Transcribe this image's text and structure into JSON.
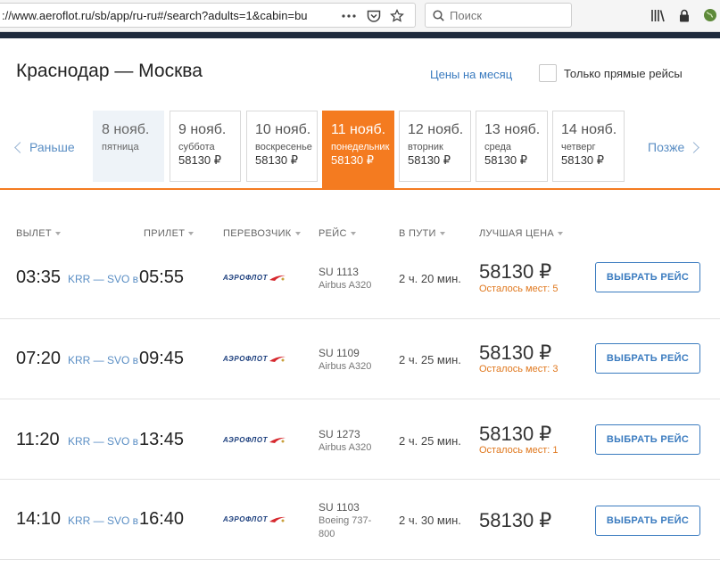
{
  "browser": {
    "url": "://www.aeroflot.ru/sb/app/ru-ru#/search?adults=1&cabin=bu",
    "search_placeholder": "Поиск"
  },
  "header": {
    "route_title": "Краснодар — Москва",
    "month_prices_link": "Цены на месяц",
    "direct_only_label": "Только прямые рейсы"
  },
  "date_strip": {
    "prev_label": "Раньше",
    "next_label": "Позже",
    "days": [
      {
        "date": "8 нояб.",
        "weekday": "пятница",
        "price": ""
      },
      {
        "date": "9 нояб.",
        "weekday": "суббота",
        "price": "58130 ₽"
      },
      {
        "date": "10 нояб.",
        "weekday": "воскресенье",
        "price": "58130 ₽"
      },
      {
        "date": "11 нояб.",
        "weekday": "понедельник",
        "price": "58130 ₽"
      },
      {
        "date": "12 нояб.",
        "weekday": "вторник",
        "price": "58130 ₽"
      },
      {
        "date": "13 нояб.",
        "weekday": "среда",
        "price": "58130 ₽"
      },
      {
        "date": "14 нояб.",
        "weekday": "четверг",
        "price": "58130 ₽"
      }
    ]
  },
  "table_headers": {
    "departure": "ВЫЛЕТ",
    "arrival": "ПРИЛЕТ",
    "carrier": "ПЕРЕВОЗЧИК",
    "flight": "РЕЙС",
    "duration": "В ПУТИ",
    "best_price": "ЛУЧШАЯ ЦЕНА"
  },
  "carrier_logo_text": "АЭРОФЛОТ",
  "flights": [
    {
      "dep": "03:35",
      "route": "KRR — SVO в",
      "arr": "05:55",
      "flight": "SU 1113",
      "aircraft": "Airbus A320",
      "duration": "2 ч. 20 мин.",
      "price": "58130 ₽",
      "seats": "Осталось мест: 5",
      "button": "ВЫБРАТЬ РЕЙС"
    },
    {
      "dep": "07:20",
      "route": "KRR — SVO в",
      "arr": "09:45",
      "flight": "SU 1109",
      "aircraft": "Airbus A320",
      "duration": "2 ч. 25 мин.",
      "price": "58130 ₽",
      "seats": "Осталось мест: 3",
      "button": "ВЫБРАТЬ РЕЙС"
    },
    {
      "dep": "11:20",
      "route": "KRR — SVO в",
      "arr": "13:45",
      "flight": "SU 1273",
      "aircraft": "Airbus A320",
      "duration": "2 ч. 25 мин.",
      "price": "58130 ₽",
      "seats": "Осталось мест: 1",
      "button": "ВЫБРАТЬ РЕЙС"
    },
    {
      "dep": "14:10",
      "route": "KRR — SVO в",
      "arr": "16:40",
      "flight": "SU 1103",
      "aircraft": "Boeing 737-800",
      "duration": "2 ч. 30 мин.",
      "price": "58130 ₽",
      "seats": "",
      "button": "ВЫБРАТЬ РЕЙС"
    }
  ],
  "colors": {
    "accent_orange": "#f47b20",
    "link_blue": "#3a7bbf",
    "seats_orange": "#e0781e"
  }
}
